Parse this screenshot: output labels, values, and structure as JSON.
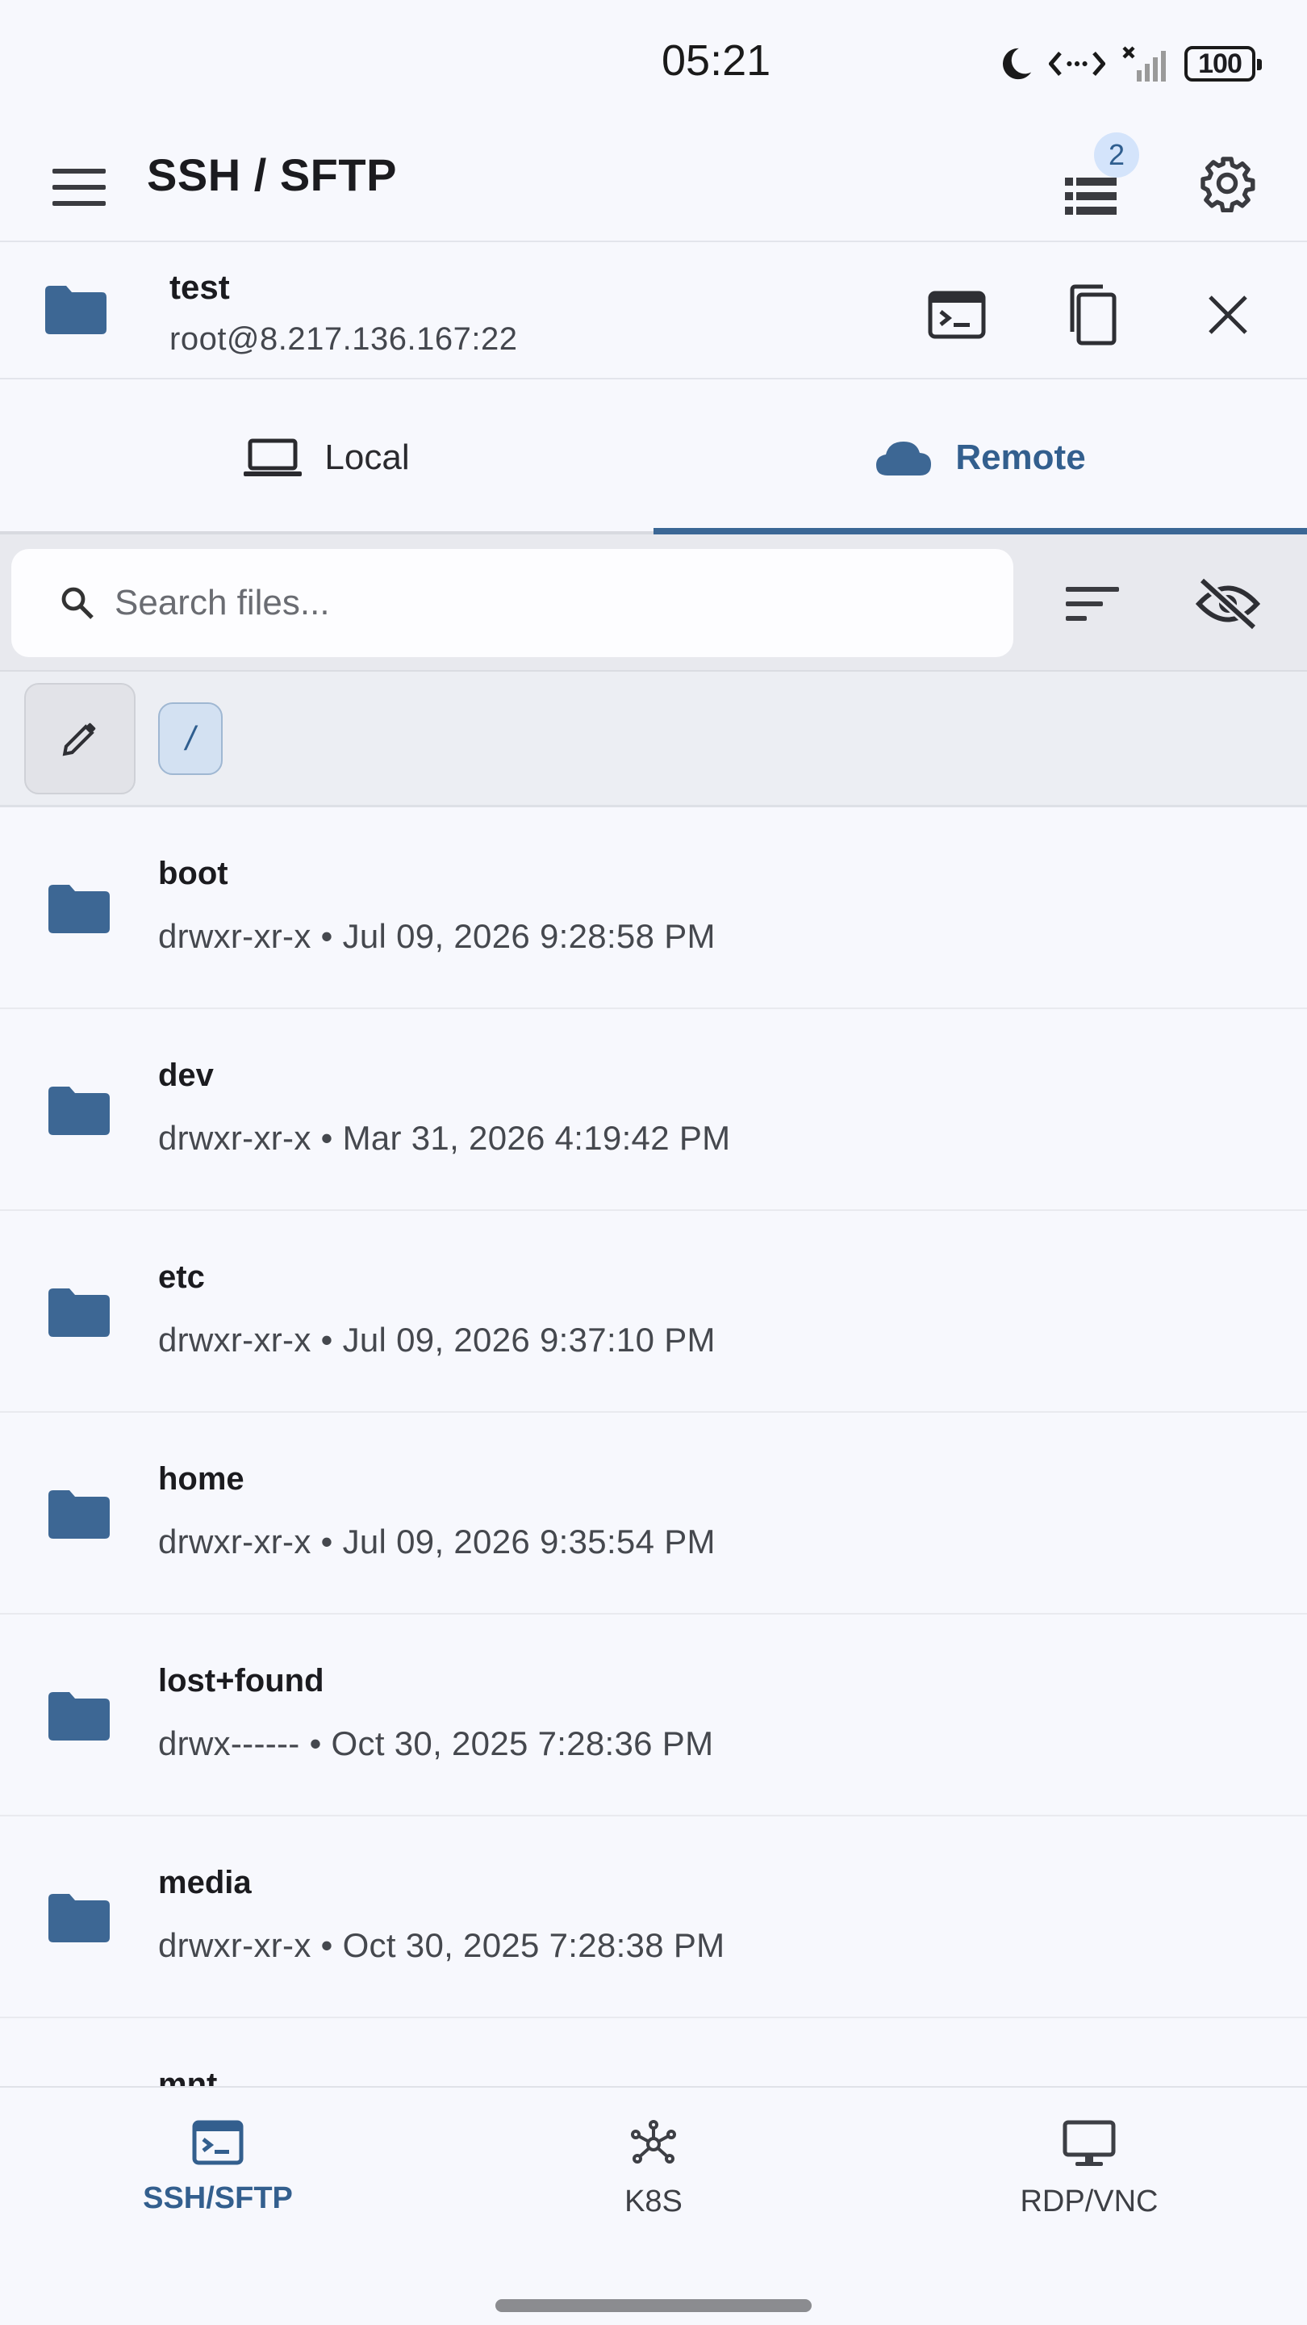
{
  "status_bar": {
    "time": "05:21",
    "battery": "100",
    "icons": [
      "moon-icon",
      "data-transfer-icon",
      "signal-icon",
      "battery-icon"
    ]
  },
  "app_bar": {
    "title": "SSH / SFTP",
    "tasks_badge": "2",
    "icons": [
      "menu-icon",
      "tasks-icon",
      "gear-icon"
    ]
  },
  "session": {
    "name": "test",
    "host": "root@8.217.136.167:22",
    "icons": [
      "folder-icon",
      "terminal-icon",
      "copy-icon",
      "close-icon"
    ]
  },
  "tabs": [
    {
      "label": "Local",
      "icon": "laptop-icon",
      "active": false
    },
    {
      "label": "Remote",
      "icon": "cloud-icon",
      "active": true
    }
  ],
  "search": {
    "placeholder": "Search files...",
    "value": ""
  },
  "path": {
    "segments": [
      "/"
    ]
  },
  "files": [
    {
      "name": "boot",
      "perms": "drwxr-xr-x",
      "date": "Jul 09, 2026 9:28:58 PM"
    },
    {
      "name": "dev",
      "perms": "drwxr-xr-x",
      "date": "Mar 31, 2026 4:19:42 PM"
    },
    {
      "name": "etc",
      "perms": "drwxr-xr-x",
      "date": "Jul 09, 2026 9:37:10 PM"
    },
    {
      "name": "home",
      "perms": "drwxr-xr-x",
      "date": "Jul 09, 2026 9:35:54 PM"
    },
    {
      "name": "lost+found",
      "perms": "drwx------",
      "date": "Oct 30, 2025 7:28:36 PM"
    },
    {
      "name": "media",
      "perms": "drwxr-xr-x",
      "date": "Oct 30, 2025 7:28:38 PM"
    },
    {
      "name": "mnt",
      "perms": "",
      "date": ""
    }
  ],
  "bottom_nav": [
    {
      "label": "SSH/SFTP",
      "icon": "terminal-icon",
      "active": true
    },
    {
      "label": "K8S",
      "icon": "kubernetes-icon",
      "active": false
    },
    {
      "label": "RDP/VNC",
      "icon": "monitor-icon",
      "active": false
    }
  ],
  "colors": {
    "accent": "#335f8e",
    "folder": "#3d6794",
    "background": "#f7f8fd"
  }
}
